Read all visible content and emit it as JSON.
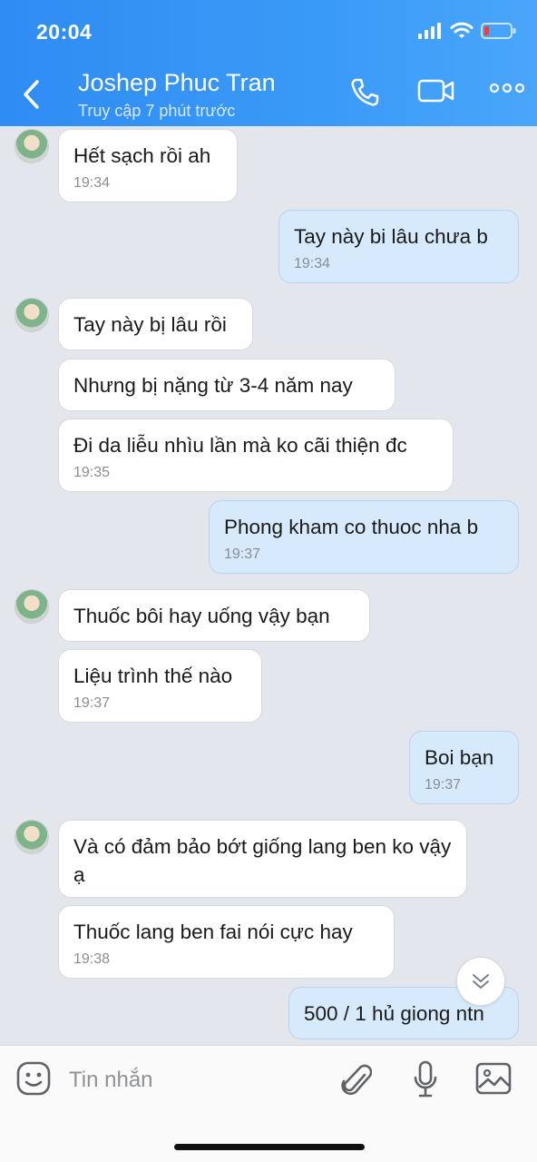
{
  "status_bar": {
    "time": "20:04"
  },
  "header": {
    "contact_name": "Joshep Phuc Tran",
    "last_seen": "Truy cập 7 phút trước"
  },
  "messages": [
    {
      "dir": "in",
      "text": "Hết sạch rồi ah",
      "time": "19:34"
    },
    {
      "dir": "out",
      "text": "Tay này bi lâu chưa b",
      "time": "19:34"
    },
    {
      "dir": "in",
      "text": "Tay này bị lâu rồi",
      "time": ""
    },
    {
      "dir": "in",
      "text": "Nhưng bị nặng từ 3-4 năm nay",
      "time": ""
    },
    {
      "dir": "in",
      "text": "Đi da liễu nhìu lần mà ko cãi thiện đc",
      "time": "19:35"
    },
    {
      "dir": "out",
      "text": "Phong kham co thuoc nha b",
      "time": "19:37"
    },
    {
      "dir": "in",
      "text": "Thuốc bôi hay uống vậy bạn",
      "time": ""
    },
    {
      "dir": "in",
      "text": "Liệu trình thế nào",
      "time": "19:37"
    },
    {
      "dir": "out",
      "text": "Boi bạn",
      "time": "19:37"
    },
    {
      "dir": "in",
      "text": "Và có đảm bảo bớt giống lang ben ko vậy ạ",
      "time": ""
    },
    {
      "dir": "in",
      "text": "Thuốc lang ben fai nói cực hay",
      "time": "19:38"
    },
    {
      "dir": "out",
      "text": "500 / 1 hủ giong ntn",
      "time": ""
    }
  ],
  "composer": {
    "placeholder": "Tin nhắn"
  },
  "icons": {
    "back": "chevron-left-icon",
    "call": "phone-icon",
    "video": "video-camera-icon",
    "more": "more-dots-icon",
    "sticker": "smiley-sticker-icon",
    "attach": "paperclip-icon",
    "voice": "microphone-icon",
    "image": "image-gallery-icon",
    "scroll": "double-chevron-down-icon"
  },
  "colors": {
    "header": "#2f8cf3",
    "outgoing_bubble": "#d7eafb",
    "incoming_bubble": "#ffffff",
    "background": "#e3e6ec"
  }
}
